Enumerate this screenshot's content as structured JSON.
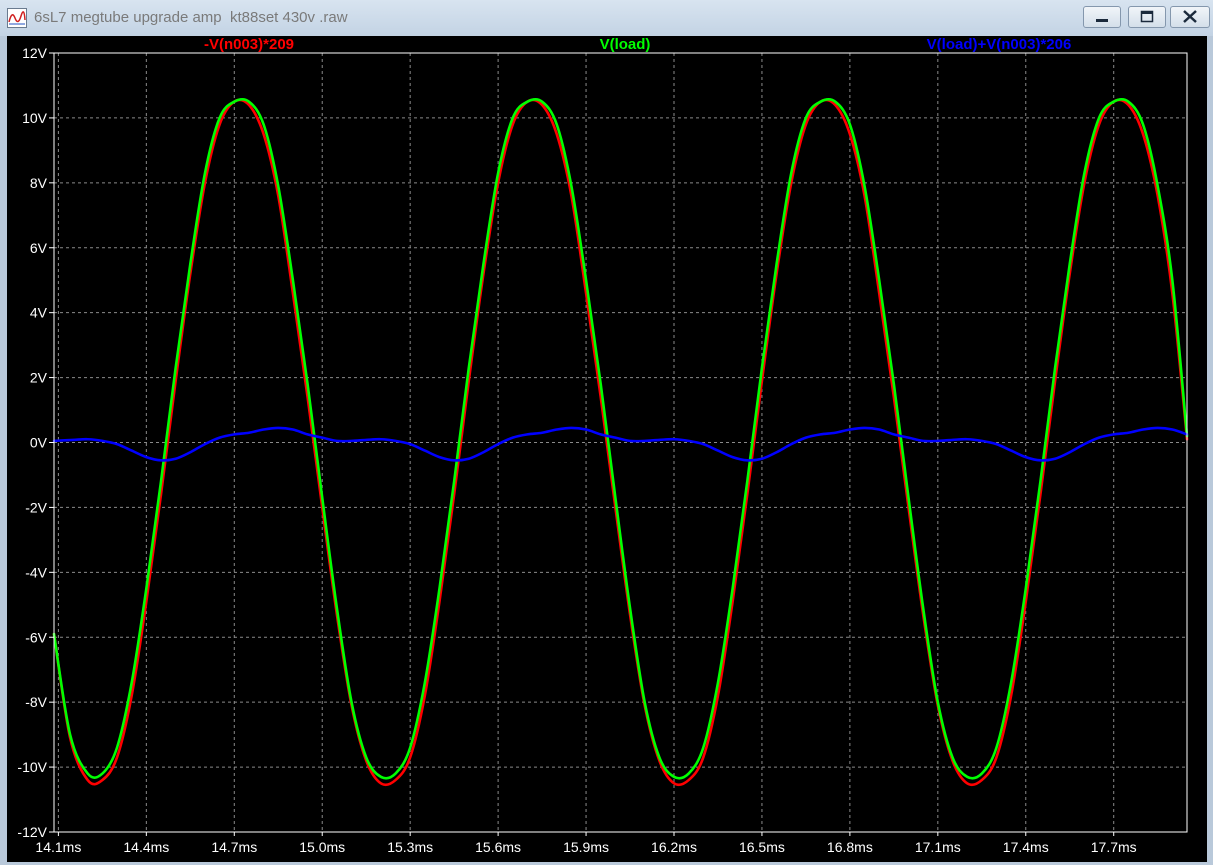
{
  "window": {
    "title": "6sL7 megtube upgrade amp  kt88set 430v .raw",
    "icon": "waveform-icon",
    "controls": [
      "minimize-icon",
      "maximize-icon",
      "close-icon"
    ]
  },
  "chart_data": {
    "type": "line",
    "title": "",
    "xlabel": "",
    "ylabel": "",
    "xlim": [
      14.085,
      17.95
    ],
    "ylim": [
      -12,
      12
    ],
    "x_unit": "ms",
    "y_unit": "V",
    "xticks": [
      "14.1ms",
      "14.4ms",
      "14.7ms",
      "15.0ms",
      "15.3ms",
      "15.6ms",
      "15.9ms",
      "16.2ms",
      "16.5ms",
      "16.8ms",
      "17.1ms",
      "17.4ms",
      "17.7ms"
    ],
    "xtick_values": [
      14.1,
      14.4,
      14.7,
      15.0,
      15.3,
      15.6,
      15.9,
      16.2,
      16.5,
      16.8,
      17.1,
      17.4,
      17.7
    ],
    "yticks": [
      "12V",
      "10V",
      "8V",
      "6V",
      "4V",
      "2V",
      "0V",
      "-2V",
      "-4V",
      "-6V",
      "-8V",
      "-10V",
      "-12V"
    ],
    "ytick_values": [
      12,
      10,
      8,
      6,
      4,
      2,
      0,
      -2,
      -4,
      -6,
      -8,
      -10,
      -12
    ],
    "grid": true,
    "legend": "top",
    "series": [
      {
        "name": "-V(n003)*209",
        "color": "#ff0000",
        "x": [
          14.085,
          14.14,
          14.2,
          14.25,
          14.3,
          14.35,
          14.4,
          14.45,
          14.5,
          14.55,
          14.6,
          14.65,
          14.7,
          14.75,
          14.8,
          14.85,
          14.9,
          14.95,
          15.0,
          15.05,
          15.1,
          15.15,
          15.2,
          15.25,
          15.3,
          15.35,
          15.4,
          15.45,
          15.5,
          15.55,
          15.6,
          15.65,
          15.7,
          15.75,
          15.8,
          15.85,
          15.9,
          15.95,
          16.0,
          16.05,
          16.1,
          16.15,
          16.2,
          16.25,
          16.3,
          16.35,
          16.4,
          16.45,
          16.5,
          16.55,
          16.6,
          16.65,
          16.7,
          16.75,
          16.8,
          16.85,
          16.9,
          16.95,
          17.0,
          17.05,
          17.1,
          17.15,
          17.2,
          17.25,
          17.3,
          17.35,
          17.4,
          17.45,
          17.5,
          17.55,
          17.6,
          17.65,
          17.7,
          17.75,
          17.8,
          17.85,
          17.9,
          17.95
        ],
        "y": [
          -5.9,
          -9.1,
          -10.4,
          -10.4,
          -9.7,
          -7.8,
          -4.9,
          -1.6,
          1.9,
          5.2,
          8.0,
          9.8,
          10.5,
          10.4,
          9.5,
          7.6,
          4.6,
          1.4,
          -2.0,
          -5.3,
          -8.1,
          -9.8,
          -10.5,
          -10.4,
          -9.7,
          -7.8,
          -4.9,
          -1.6,
          1.9,
          5.2,
          8.0,
          9.8,
          10.5,
          10.4,
          9.5,
          7.6,
          4.6,
          1.4,
          -2.0,
          -5.3,
          -8.1,
          -9.8,
          -10.5,
          -10.4,
          -9.7,
          -7.8,
          -4.9,
          -1.6,
          1.9,
          5.2,
          8.0,
          9.8,
          10.5,
          10.4,
          9.5,
          7.6,
          4.6,
          1.4,
          -2.0,
          -5.3,
          -8.1,
          -9.8,
          -10.5,
          -10.4,
          -9.7,
          -7.8,
          -4.9,
          -1.6,
          1.9,
          5.2,
          8.0,
          9.8,
          10.5,
          10.4,
          9.5,
          7.6,
          4.6,
          0.1
        ]
      },
      {
        "name": "V(load)",
        "color": "#00ff00",
        "x": [
          14.085,
          14.14,
          14.2,
          14.25,
          14.3,
          14.35,
          14.4,
          14.45,
          14.5,
          14.55,
          14.6,
          14.65,
          14.7,
          14.75,
          14.8,
          14.85,
          14.9,
          14.95,
          15.0,
          15.05,
          15.1,
          15.15,
          15.2,
          15.25,
          15.3,
          15.35,
          15.4,
          15.45,
          15.5,
          15.55,
          15.6,
          15.65,
          15.7,
          15.75,
          15.8,
          15.85,
          15.9,
          15.95,
          16.0,
          16.05,
          16.1,
          16.15,
          16.2,
          16.25,
          16.3,
          16.35,
          16.4,
          16.45,
          16.5,
          16.55,
          16.6,
          16.65,
          16.7,
          16.75,
          16.8,
          16.85,
          16.9,
          16.95,
          17.0,
          17.05,
          17.1,
          17.15,
          17.2,
          17.25,
          17.3,
          17.35,
          17.4,
          17.45,
          17.5,
          17.55,
          17.6,
          17.65,
          17.7,
          17.75,
          17.8,
          17.85,
          17.9,
          17.95
        ],
        "y": [
          -5.9,
          -9.0,
          -10.2,
          -10.2,
          -9.4,
          -7.4,
          -4.5,
          -1.2,
          2.3,
          5.5,
          8.3,
          10.0,
          10.5,
          10.5,
          9.8,
          7.9,
          5.0,
          1.8,
          -1.7,
          -5.1,
          -8.0,
          -9.7,
          -10.3,
          -10.2,
          -9.4,
          -7.4,
          -4.5,
          -1.2,
          2.3,
          5.5,
          8.3,
          10.0,
          10.5,
          10.5,
          9.8,
          7.9,
          5.0,
          1.8,
          -1.7,
          -5.1,
          -8.0,
          -9.7,
          -10.3,
          -10.2,
          -9.4,
          -7.4,
          -4.5,
          -1.2,
          2.3,
          5.5,
          8.3,
          10.0,
          10.5,
          10.5,
          9.8,
          7.9,
          5.0,
          1.8,
          -1.7,
          -5.1,
          -8.0,
          -9.7,
          -10.3,
          -10.2,
          -9.4,
          -7.4,
          -4.5,
          -1.2,
          2.3,
          5.5,
          8.3,
          10.0,
          10.5,
          10.5,
          9.8,
          7.9,
          5.0,
          0.2
        ]
      },
      {
        "name": "V(load)+V(n003)*206",
        "color": "#0000ff",
        "x": [
          14.085,
          14.15,
          14.2,
          14.25,
          14.3,
          14.35,
          14.4,
          14.45,
          14.5,
          14.55,
          14.6,
          14.65,
          14.7,
          14.75,
          14.8,
          14.85,
          14.9,
          14.95,
          15.0,
          15.05,
          15.1,
          15.15,
          15.2,
          15.25,
          15.3,
          15.35,
          15.4,
          15.45,
          15.5,
          15.55,
          15.6,
          15.65,
          15.7,
          15.75,
          15.8,
          15.85,
          15.9,
          15.95,
          16.0,
          16.05,
          16.1,
          16.15,
          16.2,
          16.25,
          16.3,
          16.35,
          16.4,
          16.45,
          16.5,
          16.55,
          16.6,
          16.65,
          16.7,
          16.75,
          16.8,
          16.85,
          16.9,
          16.95,
          17.0,
          17.05,
          17.1,
          17.15,
          17.2,
          17.25,
          17.3,
          17.35,
          17.4,
          17.45,
          17.5,
          17.55,
          17.6,
          17.65,
          17.7,
          17.75,
          17.8,
          17.85,
          17.9,
          17.95
        ],
        "y": [
          0.05,
          0.08,
          0.1,
          0.05,
          -0.05,
          -0.25,
          -0.45,
          -0.55,
          -0.5,
          -0.3,
          -0.05,
          0.15,
          0.25,
          0.3,
          0.4,
          0.45,
          0.4,
          0.25,
          0.15,
          0.05,
          0.05,
          0.08,
          0.1,
          0.05,
          -0.05,
          -0.25,
          -0.45,
          -0.55,
          -0.5,
          -0.3,
          -0.05,
          0.15,
          0.25,
          0.3,
          0.4,
          0.45,
          0.4,
          0.25,
          0.15,
          0.05,
          0.05,
          0.08,
          0.1,
          0.05,
          -0.05,
          -0.25,
          -0.45,
          -0.55,
          -0.5,
          -0.3,
          -0.05,
          0.15,
          0.25,
          0.3,
          0.4,
          0.45,
          0.4,
          0.25,
          0.15,
          0.05,
          0.05,
          0.08,
          0.1,
          0.05,
          -0.05,
          -0.25,
          -0.45,
          -0.55,
          -0.5,
          -0.3,
          -0.05,
          0.15,
          0.25,
          0.3,
          0.4,
          0.45,
          0.4,
          0.25
        ]
      }
    ]
  }
}
